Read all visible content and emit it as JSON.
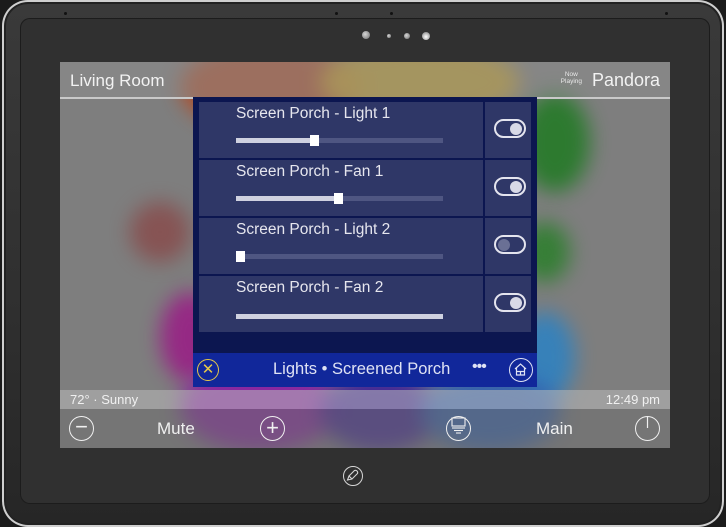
{
  "device": {
    "indicator_lights": [
      "sensor-large",
      "sensor-small",
      "sensor-medium",
      "sensor-lit"
    ],
    "logo_icon": "microphone-logo-icon"
  },
  "header": {
    "room_title": "Living Room",
    "now_playing_label_line1": "Now",
    "now_playing_label_line2": "Playing",
    "source_name": "Pandora"
  },
  "panel": {
    "loads": [
      {
        "name": "Screen Porch - Light 1",
        "level_percent": 37,
        "slider_style": "slider",
        "power": "on"
      },
      {
        "name": "Screen Porch - Fan 1",
        "level_percent": 49,
        "slider_style": "slider",
        "power": "on"
      },
      {
        "name": "Screen Porch - Light 2",
        "level_percent": 0,
        "slider_style": "slider",
        "power": "off"
      },
      {
        "name": "Screen Porch - Fan 2",
        "level_percent": 100,
        "slider_style": "line",
        "power": "on"
      }
    ],
    "footer": {
      "close_icon": "close-icon",
      "close_glyph": "✕",
      "title": "Lights • Screened Porch",
      "more_glyph": "•••",
      "home_icon": "home-icon"
    }
  },
  "statusbar": {
    "weather": "72° · Sunny",
    "time": "12:49 pm"
  },
  "bottombar": {
    "volume_down_glyph": "−",
    "mute_label": "Mute",
    "volume_up_glyph": "+",
    "main_label": "Main"
  },
  "colors": {
    "panel_bg": "#0c1650",
    "row_bg": "#2f3767",
    "footer_bg": "#11279a",
    "close_accent": "#e6c84a"
  }
}
